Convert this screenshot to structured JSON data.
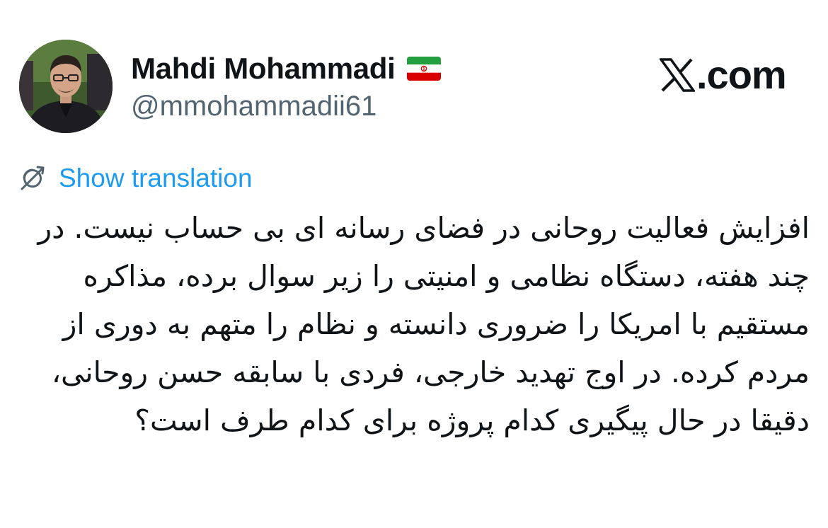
{
  "author": {
    "display_name": "Mahdi Mohammadi",
    "flag_icon": "iran-flag-icon",
    "handle": "@mmohammadii61",
    "avatar_icon": "profile-photo"
  },
  "brand": {
    "logo_icon": "x-logo-icon",
    "domain_text": ".com"
  },
  "translation": {
    "icon": "globe-icon",
    "label": "Show translation",
    "color": "#1d9bf0"
  },
  "tweet": {
    "text": "افزایش فعالیت روحانی در فضای رسانه ای بی حساب نیست. در چند هفته، دستگاه نظامی و امنیتی را زیر سوال برده، مذاکره مستقیم با امریکا را ضروری دانسته و نظام را متهم به دوری از مردم کرده. در اوج تهدید خارجی، فردی با سابقه حسن روحانی، دقیقا در حال پیگیری کدام پروژه برای کدام طرف است؟"
  },
  "colors": {
    "text_primary": "#0f1419",
    "text_secondary": "#536471",
    "link": "#1d9bf0"
  }
}
